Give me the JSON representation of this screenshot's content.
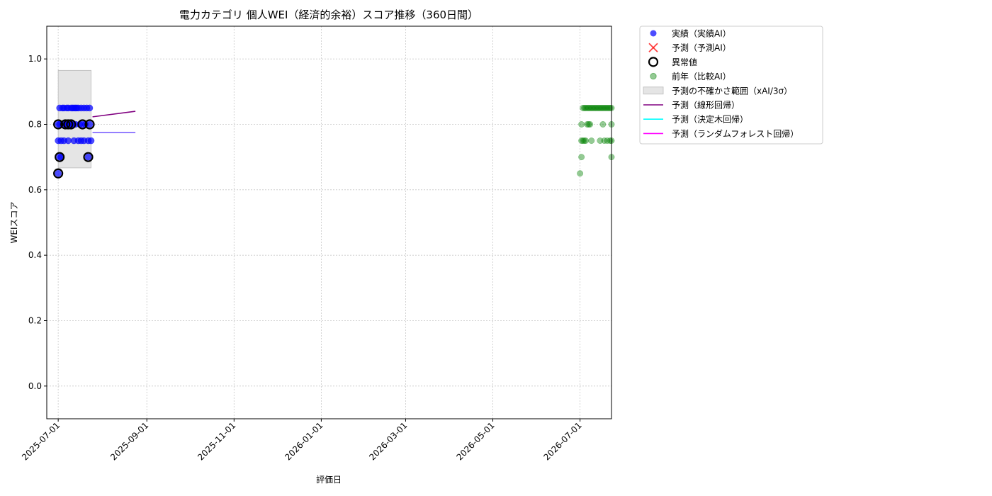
{
  "chart_data": {
    "type": "scatter",
    "title": "電力カテゴリ 個人WEI（経済的余裕）スコア推移（360日間）",
    "xlabel": "評価日",
    "ylabel": "WEIスコア",
    "x_range": [
      "2025-06-23",
      "2026-07-23"
    ],
    "ylim": [
      -0.1,
      1.1
    ],
    "x_ticks": [
      "2025-07-01",
      "2025-09-01",
      "2025-11-01",
      "2026-01-01",
      "2026-03-01",
      "2026-05-01",
      "2026-07-01"
    ],
    "y_ticks": [
      "0.0",
      "0.2",
      "0.4",
      "0.6",
      "0.8",
      "1.0"
    ],
    "grid": true,
    "legend_position": "outside-top-right",
    "colors": {
      "actual": "#0000ff",
      "forecast": "#ff0000",
      "anomaly": "#000000",
      "prior_year": "#008000",
      "uncertainty": "#d3d3d3",
      "linear": "#800080",
      "tree": "#00ffff",
      "forest": "#ff00ff",
      "forecast_blend": "#7b61ff"
    },
    "legend": [
      {
        "key": "actual",
        "label": "実績（実績AI）"
      },
      {
        "key": "forecast",
        "label": "予測（予測AI）"
      },
      {
        "key": "anomaly",
        "label": "異常値"
      },
      {
        "key": "prior_year",
        "label": "前年（比較AI）"
      },
      {
        "key": "uncertainty",
        "label": "予測の不確かさ範囲（xAI/3σ）"
      },
      {
        "key": "linear",
        "label": "予測（線形回帰）"
      },
      {
        "key": "tree",
        "label": "予測（決定木回帰）"
      },
      {
        "key": "forest",
        "label": "予測（ランダムフォレスト回帰）"
      }
    ],
    "series": [
      {
        "key": "actual",
        "points": [
          [
            "2025-07-01",
            0.65
          ],
          [
            "2025-07-01",
            0.8
          ],
          [
            "2025-07-01",
            0.75
          ],
          [
            "2025-07-02",
            0.7
          ],
          [
            "2025-07-02",
            0.85
          ],
          [
            "2025-07-02",
            0.8
          ],
          [
            "2025-07-03",
            0.7
          ],
          [
            "2025-07-03",
            0.75
          ],
          [
            "2025-07-04",
            0.85
          ],
          [
            "2025-07-04",
            0.8
          ],
          [
            "2025-07-05",
            0.85
          ],
          [
            "2025-07-05",
            0.75
          ],
          [
            "2025-07-06",
            0.8
          ],
          [
            "2025-07-07",
            0.85
          ],
          [
            "2025-07-07",
            0.8
          ],
          [
            "2025-07-08",
            0.85
          ],
          [
            "2025-07-08",
            0.75
          ],
          [
            "2025-07-09",
            0.8
          ],
          [
            "2025-07-10",
            0.85
          ],
          [
            "2025-07-10",
            0.8
          ],
          [
            "2025-07-11",
            0.85
          ],
          [
            "2025-07-11",
            0.8
          ],
          [
            "2025-07-12",
            0.85
          ],
          [
            "2025-07-12",
            0.75
          ],
          [
            "2025-07-13",
            0.85
          ],
          [
            "2025-07-13",
            0.8
          ],
          [
            "2025-07-14",
            0.85
          ],
          [
            "2025-07-15",
            0.85
          ],
          [
            "2025-07-15",
            0.75
          ],
          [
            "2025-07-16",
            0.8
          ],
          [
            "2025-07-17",
            0.85
          ],
          [
            "2025-07-17",
            0.75
          ],
          [
            "2025-07-18",
            0.8
          ],
          [
            "2025-07-19",
            0.85
          ],
          [
            "2025-07-19",
            0.75
          ],
          [
            "2025-07-20",
            0.8
          ],
          [
            "2025-07-21",
            0.85
          ],
          [
            "2025-07-22",
            0.7
          ],
          [
            "2025-07-22",
            0.75
          ],
          [
            "2025-07-23",
            0.85
          ],
          [
            "2025-07-23",
            0.8
          ],
          [
            "2025-07-24",
            0.75
          ]
        ]
      },
      {
        "key": "anomaly",
        "points": [
          [
            "2025-07-01",
            0.65
          ],
          [
            "2025-07-01",
            0.8
          ],
          [
            "2025-07-02",
            0.7
          ],
          [
            "2025-07-06",
            0.8
          ],
          [
            "2025-07-08",
            0.8
          ],
          [
            "2025-07-10",
            0.8
          ],
          [
            "2025-07-18",
            0.8
          ],
          [
            "2025-07-22",
            0.7
          ],
          [
            "2025-07-23",
            0.8
          ]
        ]
      },
      {
        "key": "prior_year",
        "points": [
          [
            "2026-07-01",
            0.65
          ],
          [
            "2026-07-02",
            0.8
          ],
          [
            "2026-07-02",
            0.75
          ],
          [
            "2026-07-02",
            0.7
          ],
          [
            "2026-07-03",
            0.85
          ],
          [
            "2026-07-03",
            0.75
          ],
          [
            "2026-07-04",
            0.85
          ],
          [
            "2026-07-04",
            0.75
          ],
          [
            "2026-07-05",
            0.85
          ],
          [
            "2026-07-05",
            0.75
          ],
          [
            "2026-07-06",
            0.85
          ],
          [
            "2026-07-06",
            0.8
          ],
          [
            "2026-07-07",
            0.85
          ],
          [
            "2026-07-07",
            0.8
          ],
          [
            "2026-07-08",
            0.85
          ],
          [
            "2026-07-08",
            0.8
          ],
          [
            "2026-07-09",
            0.85
          ],
          [
            "2026-07-09",
            0.75
          ],
          [
            "2026-07-10",
            0.85
          ],
          [
            "2026-07-11",
            0.85
          ],
          [
            "2026-07-12",
            0.85
          ],
          [
            "2026-07-13",
            0.85
          ],
          [
            "2026-07-14",
            0.85
          ],
          [
            "2026-07-15",
            0.85
          ],
          [
            "2026-07-15",
            0.75
          ],
          [
            "2026-07-16",
            0.85
          ],
          [
            "2026-07-17",
            0.85
          ],
          [
            "2026-07-17",
            0.8
          ],
          [
            "2026-07-18",
            0.85
          ],
          [
            "2026-07-18",
            0.75
          ],
          [
            "2026-07-19",
            0.85
          ],
          [
            "2026-07-20",
            0.85
          ],
          [
            "2026-07-20",
            0.75
          ],
          [
            "2026-07-21",
            0.85
          ],
          [
            "2026-07-22",
            0.85
          ],
          [
            "2026-07-22",
            0.75
          ],
          [
            "2026-07-23",
            0.85
          ],
          [
            "2026-07-23",
            0.8
          ],
          [
            "2026-07-23",
            0.75
          ],
          [
            "2026-07-23",
            0.7
          ]
        ]
      }
    ],
    "uncertainty_band": {
      "x_start": "2025-07-01",
      "x_end": "2025-07-24",
      "y_low": 0.667,
      "y_high": 0.965
    },
    "lines": [
      {
        "key": "linear",
        "points": [
          [
            "2025-07-25",
            0.823
          ],
          [
            "2025-08-24",
            0.84
          ]
        ]
      },
      {
        "key": "forecast_blend",
        "points": [
          [
            "2025-07-25",
            0.775
          ],
          [
            "2025-08-24",
            0.775
          ]
        ]
      }
    ]
  }
}
